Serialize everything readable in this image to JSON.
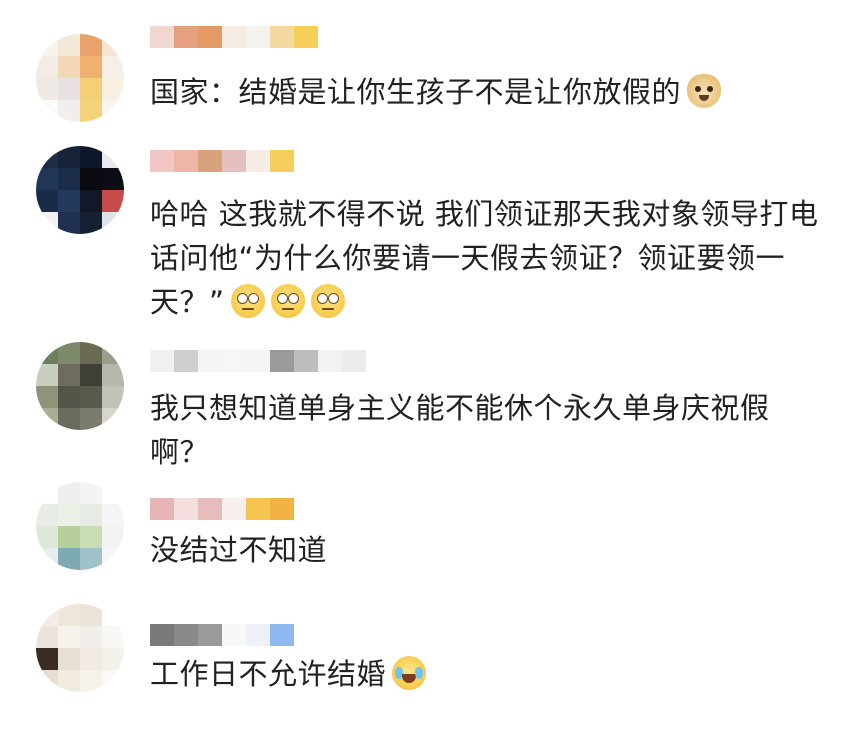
{
  "comments": [
    {
      "id": "c1",
      "text": "国家：结婚是让你生孩子不是让你放假的",
      "emoji": [
        "doge"
      ],
      "avatar_colors": [
        "#f7f2ea",
        "#f3e9d9",
        "#e8a26a",
        "#f6e4cf",
        "#f2ece4",
        "#f2d8b4",
        "#f0b070",
        "#f6efe8",
        "#efe9e6",
        "#e8dfe0",
        "#f5cf75",
        "#f8f0e2",
        "#fafafa",
        "#f1eeee",
        "#f4d27c",
        "#faf6ee"
      ],
      "nick_colors": [
        "#f0d8d0",
        "#e7a07f",
        "#e39a64",
        "#f4ebe3",
        "#f6f3ee",
        "#f3d9a0",
        "#f6cf5a"
      ]
    },
    {
      "id": "c2",
      "text": "哈哈 这我就不得不说 我们领证那天我对象领导打电话问他“为什么你要请一天假去领证？领证要领一天？”",
      "emoji": [
        "eye-roll",
        "eye-roll",
        "eye-roll"
      ],
      "avatar_colors": [
        "#1e2c45",
        "#152238",
        "#0e172a",
        "#e7e9ee",
        "#203657",
        "#1a2c4a",
        "#0a0a10",
        "#0b0d14",
        "#182b48",
        "#243a5c",
        "#121826",
        "#c94a4a",
        "#f2f2f4",
        "#1f3050",
        "#152033",
        "#e0e2e8"
      ],
      "nick_colors": [
        "#f3c6c6",
        "#edb6a8",
        "#d8a27b",
        "#e6c0c0",
        "#f6ede6",
        "#f6cf5a"
      ]
    },
    {
      "id": "c3",
      "text": "我只想知道单身主义能不能休个永久单身庆祝假啊？",
      "emoji": [],
      "avatar_colors": [
        "#6f7f5e",
        "#7d8a6a",
        "#6a6a52",
        "#9aa08a",
        "#c8cec0",
        "#6e6c5c",
        "#3f3f36",
        "#b7b7ac",
        "#8e9478",
        "#545448",
        "#5a5a4c",
        "#c2c2b8",
        "#a8ad96",
        "#6c6c5e",
        "#7c7c6e",
        "#d6d6cc"
      ],
      "nick_colors": [
        "#f0f0f0",
        "#cfcfcf",
        "#f5f5f5",
        "#f6f6f6",
        "#f5f5f5",
        "#9a9a9a",
        "#bdbdbd",
        "#f2f2f2",
        "#ececec"
      ]
    },
    {
      "id": "c4",
      "text": "没结过不知道",
      "emoji": [],
      "avatar_colors": [
        "#ffffff",
        "#eef0ee",
        "#f3f3f3",
        "#ffffff",
        "#e8ece6",
        "#eaf0e6",
        "#e6ebe3",
        "#f5f5f5",
        "#dfe7d8",
        "#b7cf9b",
        "#c8dcb6",
        "#f2f2f2",
        "#e6eef0",
        "#7eaab4",
        "#9fc1c8",
        "#f4f6f6"
      ],
      "nick_colors": [
        "#e6b6b6",
        "#f4dede",
        "#e7bcbc",
        "#f8eeee",
        "#f6c450",
        "#f3b342"
      ]
    },
    {
      "id": "c5",
      "text": "工作日不允许结婚",
      "emoji": [
        "crying-laughing"
      ],
      "avatar_colors": [
        "#f3ede6",
        "#efe6da",
        "#ece3d8",
        "#ffffff",
        "#ece4dc",
        "#f7f2ec",
        "#f2eee8",
        "#f9f7f4",
        "#3a2c22",
        "#e8dfd4",
        "#f0eae2",
        "#f4f1ec",
        "#e7ddd0",
        "#f1ebe2",
        "#f6f1ea",
        "#fbf9f6"
      ],
      "nick_colors": [
        "#7a7a7a",
        "#8a8a8a",
        "#9a9a9a",
        "#f8f8f8",
        "#eef2f8",
        "#8fb8f0"
      ]
    }
  ]
}
